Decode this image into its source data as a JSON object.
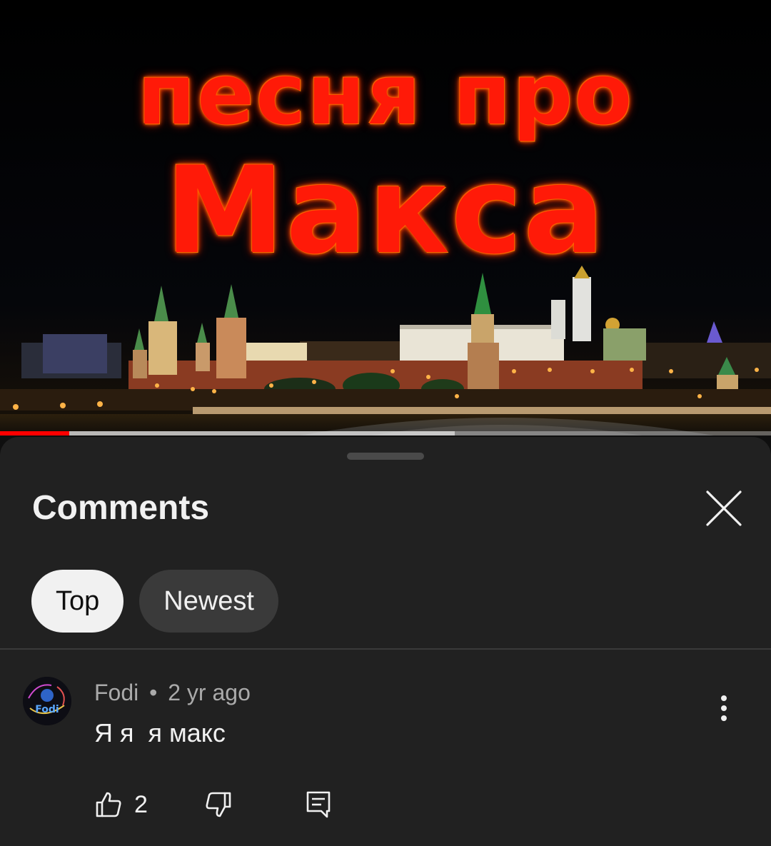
{
  "video": {
    "title_line_1": "песня про",
    "title_line_2": "Макса",
    "progress_played_fraction": 0.09,
    "progress_buffered_fraction": 0.59
  },
  "comments_panel": {
    "title": "Comments",
    "sort_chips": [
      {
        "label": "Top",
        "active": true
      },
      {
        "label": "Newest",
        "active": false
      }
    ]
  },
  "comments": [
    {
      "author": "Fodi",
      "separator": "•",
      "age": "2 yr ago",
      "text": "Я я  я макс",
      "like_count": "2",
      "avatar_text": "Fodi"
    }
  ],
  "icons": {
    "close": "close-icon",
    "more": "more-vert-icon",
    "like": "thumbs-up-icon",
    "dislike": "thumbs-down-icon",
    "reply": "reply-icon"
  },
  "colors": {
    "sheet_bg": "#212121",
    "progress_red": "#ff0000",
    "title_fire_red": "#ff1a08",
    "chip_active_bg": "#f1f1f1",
    "chip_inactive_bg": "#3a3a3a"
  }
}
